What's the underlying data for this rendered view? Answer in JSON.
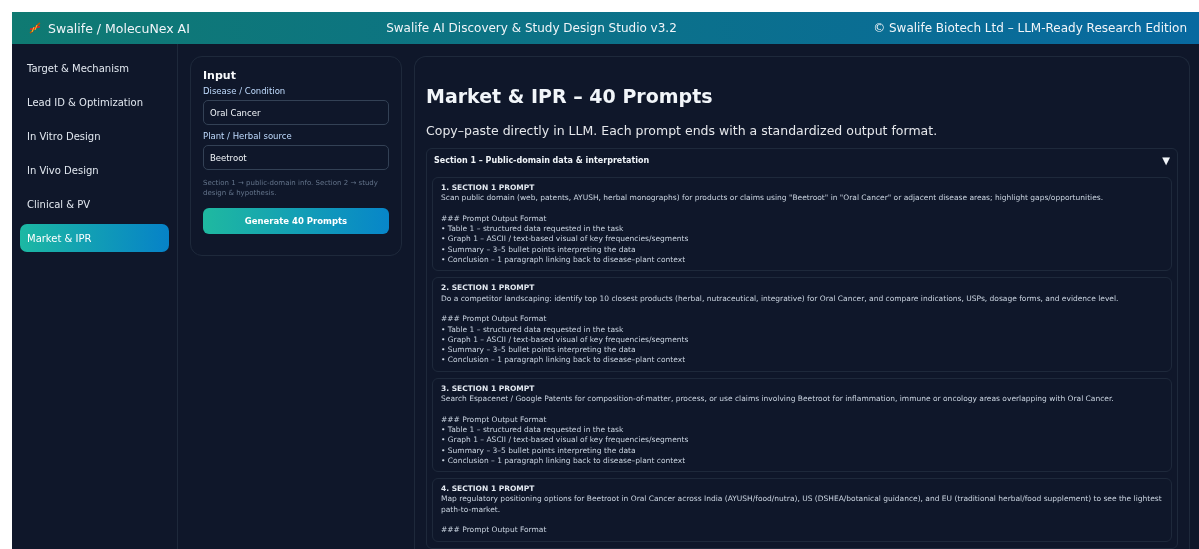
{
  "header": {
    "brand": "Swalife / MolecuNex AI",
    "title": "Swalife AI Discovery & Study Design Studio v3.2",
    "edition": "© Swalife Biotech Ltd – LLM-Ready Research Edition"
  },
  "sidebar": {
    "items": [
      {
        "label": "Target & Mechanism",
        "selected": false
      },
      {
        "label": "Lead ID & Optimization",
        "selected": false
      },
      {
        "label": "In Vitro Design",
        "selected": false
      },
      {
        "label": "In Vivo Design",
        "selected": false
      },
      {
        "label": "Clinical & PV",
        "selected": false
      },
      {
        "label": "Market & IPR",
        "selected": true
      }
    ]
  },
  "input_panel": {
    "title": "Input",
    "fields": [
      {
        "label": "Disease / Condition",
        "value": "Oral Cancer"
      },
      {
        "label": "Plant / Herbal source",
        "value": "Beetroot"
      }
    ],
    "hint": "Section 1 → public-domain info. Section 2 → study design & hypothesis.",
    "button": "Generate 40 Prompts"
  },
  "main": {
    "title": "Market & IPR – 40 Prompts",
    "subtitle": "Copy–paste directly in LLM. Each prompt ends with a standardized output format.",
    "section": {
      "title": "Section 1 – Public-domain data & interpretation",
      "toggle": "▼",
      "expanded": true,
      "prompts": [
        {
          "title": "1. SECTION 1 PROMPT",
          "text": "Scan public domain (web, patents, AYUSH, herbal monographs) for products or claims using \"Beetroot\" in \"Oral Cancer\" or adjacent disease areas; highlight gaps/opportunities.",
          "format_title": "### Prompt Output Format",
          "format_items": [
            "• Table 1 – structured data requested in the task",
            "• Graph 1 – ASCII / text-based visual of key frequencies/segments",
            "• Summary – 3–5 bullet points interpreting the data",
            "• Conclusion – 1 paragraph linking back to disease–plant context"
          ]
        },
        {
          "title": "2. SECTION 1 PROMPT",
          "text": "Do a competitor landscaping: identify top 10 closest products (herbal, nutraceutical, integrative) for Oral Cancer, and compare indications, USPs, dosage forms, and evidence level.",
          "format_title": "### Prompt Output Format",
          "format_items": [
            "• Table 1 – structured data requested in the task",
            "• Graph 1 – ASCII / text-based visual of key frequencies/segments",
            "• Summary – 3–5 bullet points interpreting the data",
            "• Conclusion – 1 paragraph linking back to disease–plant context"
          ]
        },
        {
          "title": "3. SECTION 1 PROMPT",
          "text": "Search Espacenet / Google Patents for composition-of-matter, process, or use claims involving Beetroot for inflammation, immune or oncology areas overlapping with Oral Cancer.",
          "format_title": "### Prompt Output Format",
          "format_items": [
            "• Table 1 – structured data requested in the task",
            "• Graph 1 – ASCII / text-based visual of key frequencies/segments",
            "• Summary – 3–5 bullet points interpreting the data",
            "• Conclusion – 1 paragraph linking back to disease–plant context"
          ]
        },
        {
          "title": "4. SECTION 1 PROMPT",
          "text": "Map regulatory positioning options for Beetroot in Oral Cancer across India (AYUSH/food/nutra), US (DSHEA/botanical guidance), and EU (traditional herbal/food supplement) to see the lightest path-to-market.",
          "format_title": "### Prompt Output Format"
        }
      ]
    }
  }
}
